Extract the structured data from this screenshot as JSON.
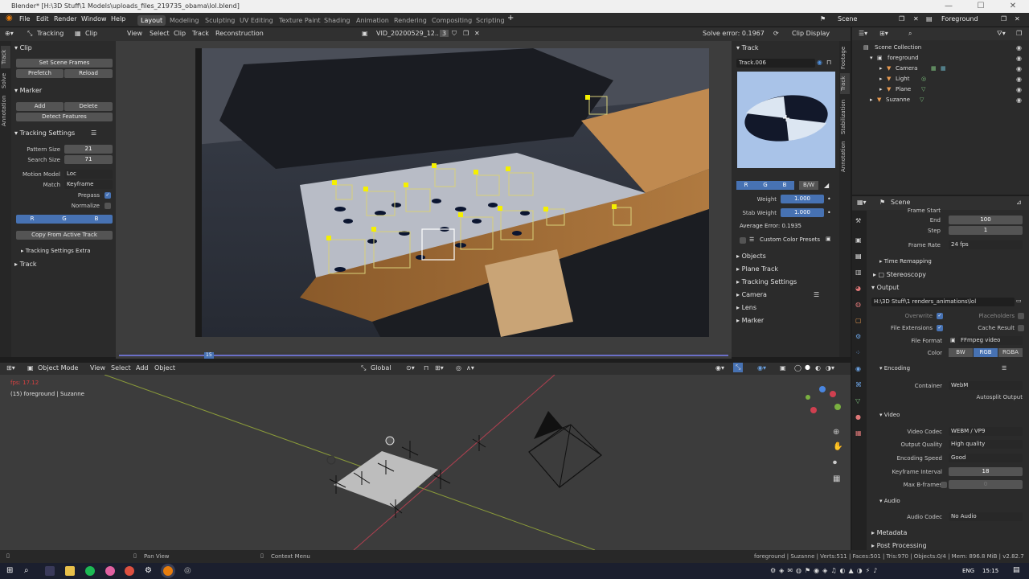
{
  "window": {
    "title": "Blender* [H:\\3D Stuff\\1 Models\\uploads_files_219735_obama\\lol.blend]",
    "minimize": "—",
    "maximize": "☐",
    "close": "✕"
  },
  "menu": [
    "File",
    "Edit",
    "Render",
    "Window",
    "Help"
  ],
  "workspaces": [
    "Layout",
    "Modeling",
    "Sculpting",
    "UV Editing",
    "Texture Paint",
    "Shading",
    "Animation",
    "Rendering",
    "Compositing",
    "Scripting"
  ],
  "top_right": {
    "scene": "Scene",
    "view_layer": "Foreground"
  },
  "clip_header": {
    "mode": "Tracking",
    "view_mode": "Clip",
    "menus": [
      "View",
      "Select",
      "Clip",
      "Track",
      "Reconstruction"
    ],
    "clip_name": "VID_20200529_12..",
    "users": "3",
    "solve_error": "Solve error: 0.1967",
    "display": "Clip Display"
  },
  "left_tabs": [
    "Track",
    "Solve",
    "Annotation"
  ],
  "clip_panel": {
    "title": "Clip",
    "set_scene_frames": "Set Scene Frames",
    "prefetch": "Prefetch",
    "reload": "Reload"
  },
  "marker_panel": {
    "title": "Marker",
    "add": "Add",
    "delete": "Delete",
    "detect": "Detect Features"
  },
  "tracking_settings": {
    "title": "Tracking Settings",
    "pattern_size_label": "Pattern Size",
    "pattern_size": "21",
    "search_size_label": "Search Size",
    "search_size": "71",
    "motion_model_label": "Motion Model",
    "motion_model": "Loc",
    "match_label": "Match",
    "match": "Keyframe",
    "prepass_label": "Prepass",
    "normalize_label": "Normalize",
    "r": "R",
    "g": "G",
    "b": "B",
    "copy": "Copy From Active Track",
    "extra": "Tracking Settings Extra",
    "track": "Track"
  },
  "track_panel": {
    "title": "Track",
    "name": "Track.006",
    "r": "R",
    "g": "G",
    "b": "B",
    "bw": "B/W",
    "weight_label": "Weight",
    "weight": "1.000",
    "stab_label": "Stab Weight",
    "stab": "1.000",
    "avg_error": "Average Error: 0.1935",
    "presets": "Custom Color Presets",
    "sections": [
      "Objects",
      "Plane Track",
      "Tracking Settings",
      "Camera",
      "Lens",
      "Marker"
    ]
  },
  "right_tabs": [
    "Footage",
    "Track",
    "Stabilization",
    "Annotation"
  ],
  "outliner": {
    "collection": "Scene Collection",
    "items": [
      {
        "name": "foreground",
        "indent": 1
      },
      {
        "name": "Camera",
        "indent": 2
      },
      {
        "name": "Light",
        "indent": 2
      },
      {
        "name": "Plane",
        "indent": 2
      },
      {
        "name": "Suzanne",
        "indent": 1
      }
    ]
  },
  "properties": {
    "scene": "Scene",
    "frame_start": "Frame Start",
    "end_label": "End",
    "end": "100",
    "step_label": "Step",
    "step": "1",
    "fps_label": "Frame Rate",
    "fps": "24 fps",
    "time_remapping": "Time Remapping",
    "stereoscopy": "Stereoscopy",
    "output": "Output",
    "path": "H:\\3D Stuff\\1 renders_animations\\lol",
    "overwrite": "Overwrite",
    "placeholders": "Placeholders",
    "file_ext": "File Extensions",
    "cache_result": "Cache Result",
    "file_format_label": "File Format",
    "file_format": "FFmpeg video",
    "color_label": "Color",
    "bw": "BW",
    "rgb": "RGB",
    "rgba": "RGBA",
    "encoding": "Encoding",
    "container_label": "Container",
    "container": "WebM",
    "autosplit": "Autosplit Output",
    "video": "Video",
    "codec_label": "Video Codec",
    "codec": "WEBM / VP9",
    "quality_label": "Output Quality",
    "quality": "High quality",
    "speed_label": "Encoding Speed",
    "speed": "Good",
    "keyframe_label": "Keyframe Interval",
    "keyframe": "18",
    "bframes_label": "Max B-frames",
    "bframes": "0",
    "audio": "Audio",
    "audio_codec_label": "Audio Codec",
    "audio_codec": "No Audio",
    "metadata": "Metadata",
    "post": "Post Processing"
  },
  "view3d": {
    "mode": "Object Mode",
    "menus": [
      "View",
      "Select",
      "Add",
      "Object"
    ],
    "orientation": "Global",
    "fps": "fps: 17.12",
    "info": "(15) foreground | Suzanne"
  },
  "timeline": {
    "frame": "15"
  },
  "status": {
    "pan": "Pan View",
    "context": "Context Menu",
    "stats": "foreground | Suzanne | Verts:511 | Faces:501 | Tris:970 | Objects:0/4 | Mem: 896.8 MiB | v2.82.7"
  },
  "taskbar": {
    "lang": "ENG",
    "time": "15:15"
  }
}
